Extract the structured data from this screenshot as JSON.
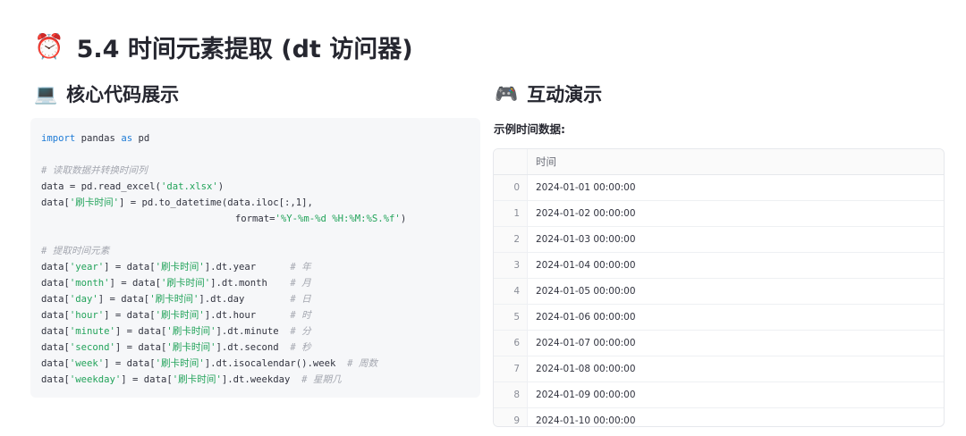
{
  "page": {
    "title_icon": "⏰",
    "title": "5.4 时间元素提取 (dt 访问器)"
  },
  "left": {
    "icon": "💻",
    "title": "核心代码展示"
  },
  "code": {
    "lines": [
      [
        {
          "t": "kw",
          "v": "import"
        },
        {
          "t": "",
          "v": " pandas "
        },
        {
          "t": "kw",
          "v": "as"
        },
        {
          "t": "",
          "v": " pd"
        }
      ],
      [],
      [
        {
          "t": "cm",
          "v": "# 读取数据并转换时间列"
        }
      ],
      [
        {
          "t": "",
          "v": "data = pd.read_excel("
        },
        {
          "t": "str",
          "v": "'dat.xlsx'"
        },
        {
          "t": "",
          "v": ")"
        }
      ],
      [
        {
          "t": "",
          "v": "data["
        },
        {
          "t": "str",
          "v": "'刷卡时间'"
        },
        {
          "t": "",
          "v": "] = pd.to_datetime(data.iloc[:,1],"
        }
      ],
      [
        {
          "t": "",
          "v": "                                  format="
        },
        {
          "t": "str",
          "v": "'%Y-%m-%d %H:%M:%S.%f'"
        },
        {
          "t": "",
          "v": ")"
        }
      ],
      [],
      [
        {
          "t": "cm",
          "v": "# 提取时间元素"
        }
      ],
      [
        {
          "t": "",
          "v": "data["
        },
        {
          "t": "str",
          "v": "'year'"
        },
        {
          "t": "",
          "v": "] = data["
        },
        {
          "t": "str",
          "v": "'刷卡时间'"
        },
        {
          "t": "",
          "v": "].dt.year      "
        },
        {
          "t": "cm",
          "v": "# 年"
        }
      ],
      [
        {
          "t": "",
          "v": "data["
        },
        {
          "t": "str",
          "v": "'month'"
        },
        {
          "t": "",
          "v": "] = data["
        },
        {
          "t": "str",
          "v": "'刷卡时间'"
        },
        {
          "t": "",
          "v": "].dt.month    "
        },
        {
          "t": "cm",
          "v": "# 月"
        }
      ],
      [
        {
          "t": "",
          "v": "data["
        },
        {
          "t": "str",
          "v": "'day'"
        },
        {
          "t": "",
          "v": "] = data["
        },
        {
          "t": "str",
          "v": "'刷卡时间'"
        },
        {
          "t": "",
          "v": "].dt.day        "
        },
        {
          "t": "cm",
          "v": "# 日"
        }
      ],
      [
        {
          "t": "",
          "v": "data["
        },
        {
          "t": "str",
          "v": "'hour'"
        },
        {
          "t": "",
          "v": "] = data["
        },
        {
          "t": "str",
          "v": "'刷卡时间'"
        },
        {
          "t": "",
          "v": "].dt.hour      "
        },
        {
          "t": "cm",
          "v": "# 时"
        }
      ],
      [
        {
          "t": "",
          "v": "data["
        },
        {
          "t": "str",
          "v": "'minute'"
        },
        {
          "t": "",
          "v": "] = data["
        },
        {
          "t": "str",
          "v": "'刷卡时间'"
        },
        {
          "t": "",
          "v": "].dt.minute  "
        },
        {
          "t": "cm",
          "v": "# 分"
        }
      ],
      [
        {
          "t": "",
          "v": "data["
        },
        {
          "t": "str",
          "v": "'second'"
        },
        {
          "t": "",
          "v": "] = data["
        },
        {
          "t": "str",
          "v": "'刷卡时间'"
        },
        {
          "t": "",
          "v": "].dt.second  "
        },
        {
          "t": "cm",
          "v": "# 秒"
        }
      ],
      [
        {
          "t": "",
          "v": "data["
        },
        {
          "t": "str",
          "v": "'week'"
        },
        {
          "t": "",
          "v": "] = data["
        },
        {
          "t": "str",
          "v": "'刷卡时间'"
        },
        {
          "t": "",
          "v": "].dt.isocalendar().week  "
        },
        {
          "t": "cm",
          "v": "# 周数"
        }
      ],
      [
        {
          "t": "",
          "v": "data["
        },
        {
          "t": "str",
          "v": "'weekday'"
        },
        {
          "t": "",
          "v": "] = data["
        },
        {
          "t": "str",
          "v": "'刷卡时间'"
        },
        {
          "t": "",
          "v": "].dt.weekday  "
        },
        {
          "t": "cm",
          "v": "# 星期几"
        }
      ]
    ]
  },
  "right": {
    "icon": "🎮",
    "title": "互动演示",
    "subheading": "示例时间数据:"
  },
  "table": {
    "column": "时间",
    "rows": [
      {
        "index": "0",
        "value": "2024-01-01 00:00:00"
      },
      {
        "index": "1",
        "value": "2024-01-02 00:00:00"
      },
      {
        "index": "2",
        "value": "2024-01-03 00:00:00"
      },
      {
        "index": "3",
        "value": "2024-01-04 00:00:00"
      },
      {
        "index": "4",
        "value": "2024-01-05 00:00:00"
      },
      {
        "index": "5",
        "value": "2024-01-06 00:00:00"
      },
      {
        "index": "6",
        "value": "2024-01-07 00:00:00"
      },
      {
        "index": "7",
        "value": "2024-01-08 00:00:00"
      },
      {
        "index": "8",
        "value": "2024-01-09 00:00:00"
      },
      {
        "index": "9",
        "value": "2024-01-10 00:00:00"
      }
    ]
  }
}
